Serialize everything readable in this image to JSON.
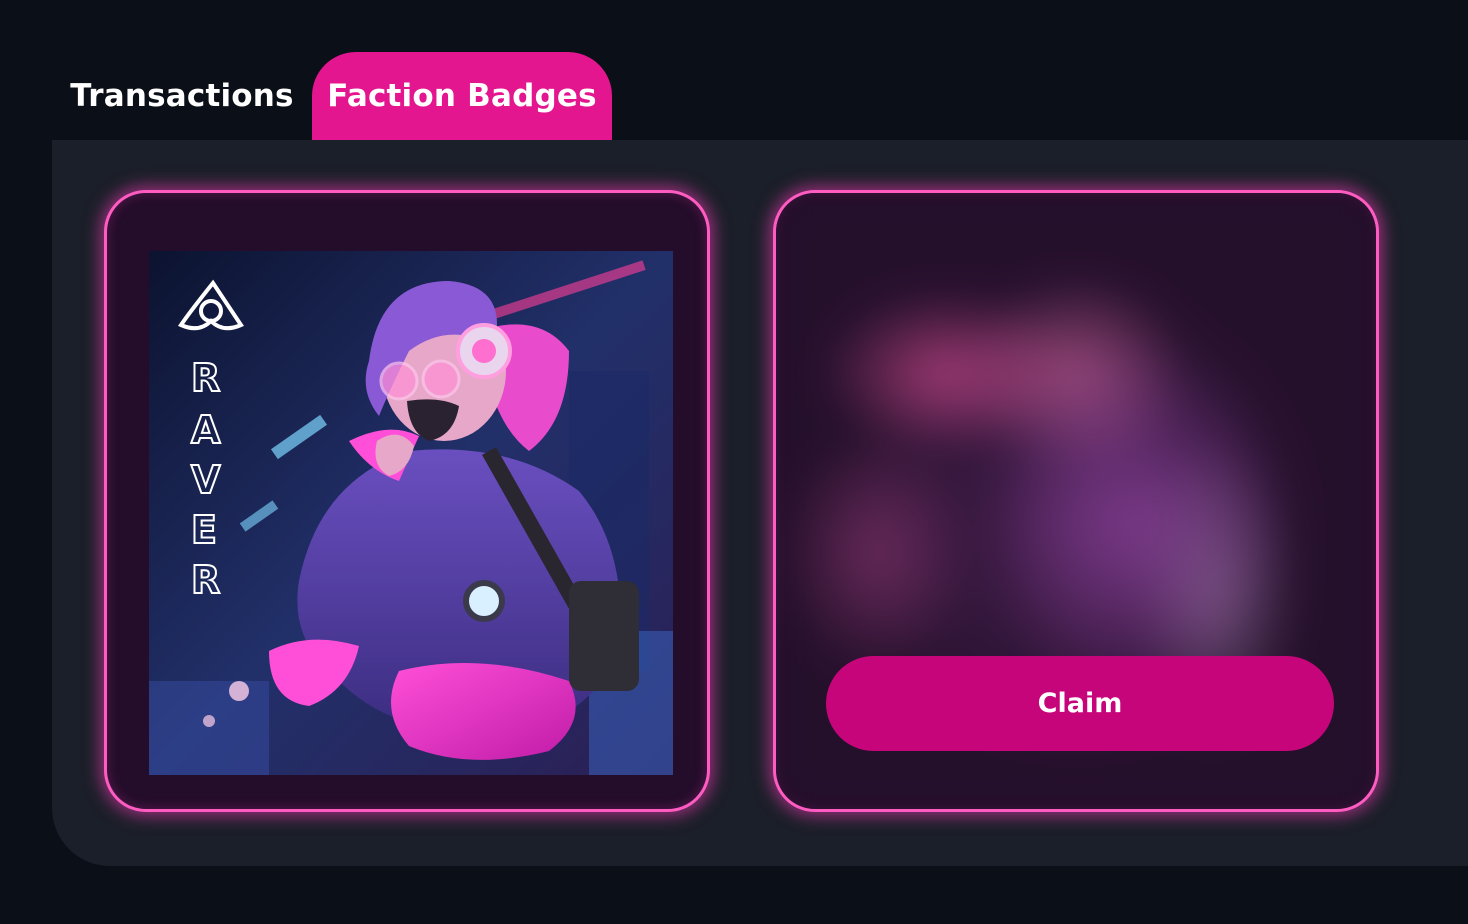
{
  "tabs": [
    {
      "label": "Transactions",
      "active": false
    },
    {
      "label": "Faction Badges",
      "active": true
    }
  ],
  "badges": [
    {
      "name": "RAVER",
      "icon": "triquetra-icon",
      "claimed": true
    },
    {
      "claim_label": "Claim",
      "claimed": false
    }
  ],
  "colors": {
    "accent": "#e4168f",
    "claim_button": "#c6057b",
    "card_border": "#ff5cc2",
    "page_bg": "#0b0f17",
    "panel_bg": "#1b1f29"
  }
}
